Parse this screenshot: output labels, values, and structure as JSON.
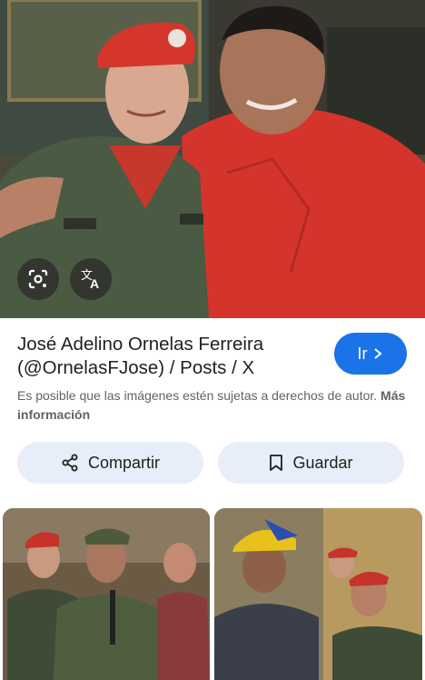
{
  "result": {
    "title": "José Adelino Ornelas Ferreira (@OrnelasFJose) / Posts / X",
    "go_label": "Ir",
    "copyright_text": "Es posible que las imágenes estén sujetas a derechos de autor.",
    "more_info_label": "Más información"
  },
  "actions": {
    "share_label": "Compartir",
    "save_label": "Guardar"
  },
  "icons": {
    "lens": "lens-icon",
    "translate": "translate-icon",
    "chevron": "chevron-right-icon",
    "share": "share-icon",
    "bookmark": "bookmark-icon"
  },
  "colors": {
    "accent": "#1a73e8",
    "button_bg": "#e8eef9",
    "text_primary": "#1f1f1f",
    "text_secondary": "#5f6368"
  }
}
